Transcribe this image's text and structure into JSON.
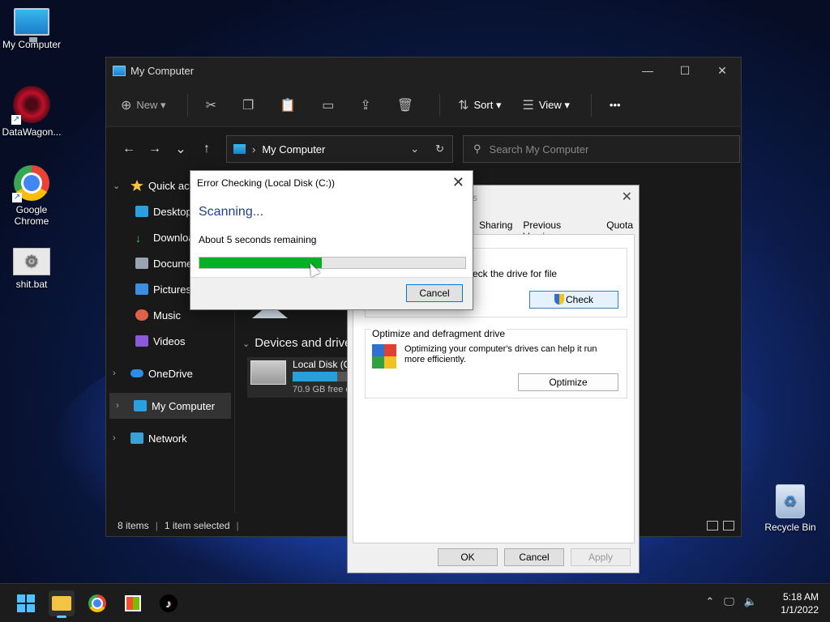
{
  "desktop": {
    "icons": [
      {
        "label": "My Computer",
        "icon": "monitor-icon"
      },
      {
        "label": "DataWagon...",
        "icon": "datawagon-icon"
      },
      {
        "label": "Google Chrome",
        "icon": "chrome-icon"
      },
      {
        "label": "shit.bat",
        "icon": "bat-file-icon"
      },
      {
        "label": "Recycle Bin",
        "icon": "recycle-bin-icon"
      }
    ]
  },
  "explorer": {
    "title": "My Computer",
    "toolbar": {
      "new": "New",
      "sort": "Sort",
      "view": "View",
      "more": "•••"
    },
    "address": "My Computer",
    "search_placeholder": "Search My Computer",
    "sidebar": {
      "quick_access": "Quick acc",
      "desktop": "Desktop",
      "downloads": "Downloa",
      "documents": "Docume",
      "pictures": "Pictures",
      "music": "Music",
      "videos": "Videos",
      "onedrive": "OneDrive",
      "my_computer": "My Computer",
      "network": "Network"
    },
    "devices_header": "Devices and drive",
    "drive": {
      "name": "Local Disk (C",
      "free": "70.9 GB free o",
      "used_fraction": 0.78
    },
    "status": {
      "items": "8 items",
      "selected": "1 item selected"
    }
  },
  "properties": {
    "title_fragment": "s",
    "tabs": [
      "Sharing",
      "Previous Versions",
      "Quota"
    ],
    "check_text": "eck the drive for file",
    "check_button": "Check",
    "optimize_title": "Optimize and defragment drive",
    "optimize_desc": "Optimizing your computer's drives can help it run more efficiently.",
    "optimize_button": "Optimize",
    "ok": "OK",
    "cancel": "Cancel",
    "apply": "Apply"
  },
  "error_check": {
    "title": "Error Checking (Local Disk (C:))",
    "status": "Scanning...",
    "remaining": "About 5 seconds remaining",
    "progress_percent": 46,
    "cancel": "Cancel"
  },
  "taskbar": {
    "time": "5:18 AM",
    "date": "1/1/2022"
  }
}
